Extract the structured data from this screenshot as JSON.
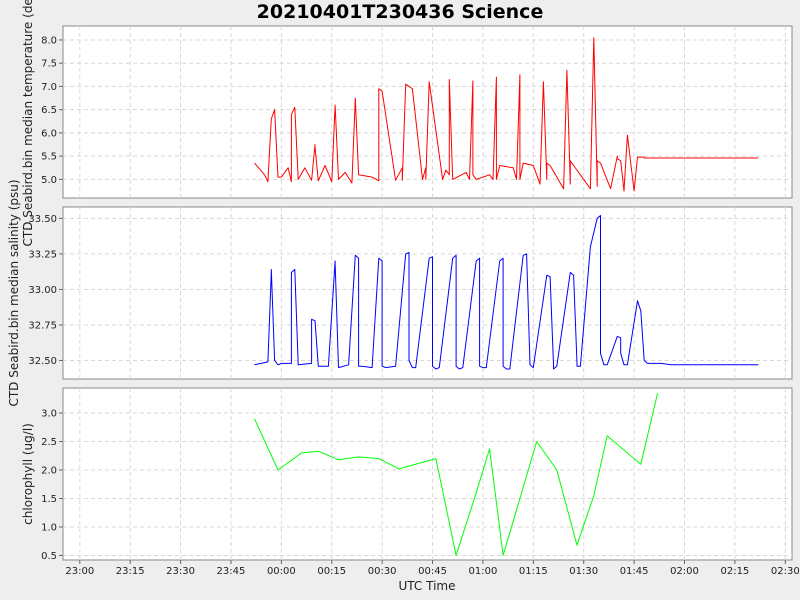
{
  "chart_data": {
    "title": "20210401T230436 Science",
    "type": "line",
    "xlabel": "UTC Time",
    "x_ticks": [
      "23:00",
      "23:15",
      "23:30",
      "23:45",
      "00:00",
      "00:15",
      "00:30",
      "00:45",
      "01:00",
      "01:15",
      "01:30",
      "01:45",
      "02:00",
      "02:15",
      "02:30"
    ],
    "xlim": [
      "22:55",
      "02:32"
    ],
    "grid": true,
    "panels": [
      {
        "ylabel": "CTD Seabird.bin median temperature (degC)",
        "ylim": [
          4.6,
          8.3
        ],
        "y_ticks": [
          "5.0",
          "5.5",
          "6.0",
          "6.5",
          "7.0",
          "7.5",
          "8.0"
        ],
        "color": "#ff0000",
        "series": [
          {
            "x": [
              "23:52",
              "23:55",
              "23:56",
              "23:57",
              "23:58",
              "23:59",
              "00:00",
              "00:02",
              "00:03",
              "00:03",
              "00:04",
              "00:05",
              "00:07",
              "00:09",
              "00:10",
              "00:10",
              "00:11",
              "00:13",
              "00:15",
              "00:16",
              "00:16",
              "00:17",
              "00:19",
              "00:21",
              "00:22",
              "00:22",
              "00:23",
              "00:27",
              "00:29",
              "00:29",
              "00:30",
              "00:34",
              "00:36",
              "00:36",
              "00:37",
              "00:39",
              "00:42",
              "00:43",
              "00:43",
              "00:44",
              "00:48",
              "00:49",
              "00:50",
              "00:50",
              "00:51",
              "00:55",
              "00:56",
              "00:57",
              "00:57",
              "00:58",
              "01:02",
              "01:03",
              "01:04",
              "01:04",
              "01:05",
              "01:09",
              "01:10",
              "01:11",
              "01:11",
              "01:12",
              "01:15",
              "01:17",
              "01:18",
              "01:19",
              "01:19",
              "01:20",
              "01:24",
              "01:25",
              "01:26",
              "01:26",
              "01:27",
              "01:32",
              "01:33",
              "01:34",
              "01:34",
              "01:35",
              "01:38",
              "01:40",
              "01:40",
              "01:41",
              "01:42",
              "01:43",
              "01:45",
              "01:46",
              "01:47",
              "01:48",
              "01:48",
              "01:49",
              "01:50",
              "01:54",
              "01:56",
              "02:22"
            ],
            "values": [
              5.35,
              5.1,
              4.95,
              6.3,
              6.5,
              5.05,
              5.05,
              5.25,
              4.95,
              6.4,
              6.55,
              5.0,
              5.25,
              4.98,
              5.75,
              5.7,
              4.97,
              5.3,
              4.95,
              6.6,
              6.6,
              5.0,
              5.15,
              4.92,
              6.75,
              6.75,
              5.1,
              5.05,
              4.97,
              6.95,
              6.9,
              4.98,
              5.25,
              4.98,
              7.05,
              6.95,
              5.0,
              5.25,
              5.0,
              7.1,
              5.0,
              5.2,
              5.1,
              7.15,
              5.0,
              5.15,
              5.0,
              7.12,
              5.1,
              5.0,
              5.1,
              5.0,
              7.2,
              5.0,
              5.3,
              5.25,
              5.0,
              7.25,
              5.0,
              5.35,
              5.3,
              4.9,
              7.1,
              5.0,
              5.35,
              5.3,
              4.8,
              7.35,
              4.9,
              5.4,
              5.3,
              4.8,
              8.05,
              4.85,
              5.4,
              5.35,
              4.8,
              5.5,
              5.45,
              5.4,
              4.75,
              5.95,
              4.75,
              5.48,
              5.48,
              5.48,
              5.46,
              5.46,
              5.46,
              5.46,
              5.46,
              5.46
            ]
          }
        ]
      },
      {
        "ylabel": "CTD Seabird.bin median salinity (psu)",
        "ylim": [
          32.37,
          33.58
        ],
        "y_ticks": [
          "32.50",
          "32.75",
          "33.00",
          "33.25",
          "33.50"
        ],
        "color": "#0000ff",
        "series": [
          {
            "x": [
              "23:52",
              "23:56",
              "23:57",
              "23:57",
              "23:58",
              "23:59",
              "00:00",
              "00:03",
              "00:03",
              "00:04",
              "00:05",
              "00:09",
              "00:09",
              "00:10",
              "00:11",
              "00:14",
              "00:16",
              "00:16",
              "00:17",
              "00:17",
              "00:20",
              "00:22",
              "00:23",
              "00:23",
              "00:24",
              "00:27",
              "00:29",
              "00:30",
              "00:30",
              "00:31",
              "00:34",
              "00:37",
              "00:38",
              "00:38",
              "00:39",
              "00:40",
              "00:44",
              "00:45",
              "00:45",
              "00:46",
              "00:47",
              "00:51",
              "00:52",
              "00:52",
              "00:53",
              "00:54",
              "00:58",
              "00:59",
              "00:59",
              "01:00",
              "01:01",
              "01:05",
              "01:06",
              "01:06",
              "01:07",
              "01:08",
              "01:12",
              "01:13",
              "01:14",
              "01:14",
              "01:15",
              "01:19",
              "01:20",
              "01:21",
              "01:21",
              "01:22",
              "01:26",
              "01:27",
              "01:28",
              "01:28",
              "01:29",
              "01:32",
              "01:34",
              "01:35",
              "01:35",
              "01:36",
              "01:37",
              "01:40",
              "01:41",
              "01:41",
              "01:42",
              "01:43",
              "01:46",
              "01:47",
              "01:48",
              "01:49",
              "01:53",
              "01:56",
              "02:22"
            ],
            "values": [
              32.47,
              32.49,
              33.12,
              33.14,
              32.5,
              32.47,
              32.48,
              32.48,
              33.12,
              33.14,
              32.47,
              32.48,
              32.79,
              32.78,
              32.46,
              32.46,
              33.2,
              33.19,
              32.45,
              32.45,
              32.47,
              33.24,
              33.22,
              32.46,
              32.46,
              32.45,
              33.22,
              33.2,
              32.46,
              32.45,
              32.46,
              33.25,
              33.26,
              32.5,
              32.45,
              32.45,
              33.22,
              33.23,
              32.46,
              32.44,
              32.45,
              33.22,
              33.24,
              32.46,
              32.44,
              32.45,
              33.2,
              33.22,
              32.46,
              32.45,
              32.45,
              33.2,
              33.22,
              32.46,
              32.44,
              32.44,
              33.24,
              33.25,
              32.47,
              32.47,
              32.45,
              33.1,
              33.09,
              32.47,
              32.44,
              32.46,
              33.12,
              33.1,
              32.48,
              32.46,
              32.46,
              33.3,
              33.5,
              33.52,
              32.55,
              32.47,
              32.47,
              32.67,
              32.66,
              32.55,
              32.47,
              32.47,
              32.92,
              32.85,
              32.5,
              32.48,
              32.48,
              32.47,
              32.47
            ]
          }
        ]
      },
      {
        "ylabel": "chlorophyll (ug/l)",
        "ylim": [
          0.42,
          3.44
        ],
        "y_ticks": [
          "0.5",
          "1.0",
          "1.5",
          "2.0",
          "2.5",
          "3.0"
        ],
        "color": "#00ff00",
        "series": [
          {
            "x": [
              "23:52",
              "23:59",
              "00:06",
              "00:11",
              "00:17",
              "00:23",
              "00:29",
              "00:35",
              "00:46",
              "00:52",
              "00:58",
              "01:02",
              "01:06",
              "01:11",
              "01:16",
              "01:22",
              "01:28",
              "01:33",
              "01:37",
              "01:47",
              "01:52"
            ],
            "values": [
              2.9,
              2.0,
              2.3,
              2.33,
              2.18,
              2.23,
              2.2,
              2.02,
              2.2,
              0.5,
              1.6,
              2.37,
              0.5,
              1.5,
              2.5,
              2.0,
              0.68,
              1.55,
              2.6,
              2.1,
              3.35
            ]
          }
        ]
      }
    ]
  }
}
